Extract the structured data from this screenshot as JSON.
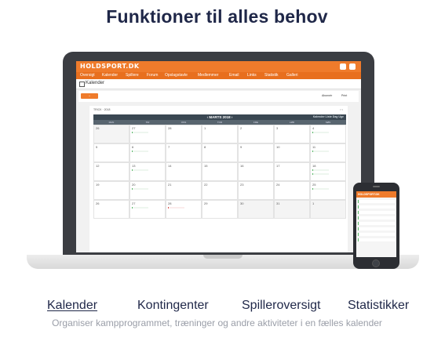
{
  "hero_title": "Funktioner til alles behov",
  "app": {
    "brand": "HOLDSPORT.DK",
    "nav": [
      "Oversigt",
      "Kalender",
      "Spillere",
      "Forum",
      "Opslagstavle",
      "Medlemmer",
      "Email",
      "Links",
      "Statistik",
      "Galleri"
    ],
    "page_title": "Kalender",
    "period_label": "TRICK · 2018",
    "toolbar_links": [
      "Abonnér",
      "Print"
    ],
    "month_title": "‹ MARTS 2018 ›",
    "views": "Kalender  Liste  Dag  Uge",
    "weekdays": [
      "MAN",
      "TIR",
      "ONS",
      "TOR",
      "FRE",
      "LØR",
      "SØN"
    ],
    "weeks": [
      [
        "26",
        "27",
        "28",
        "1",
        "2",
        "3",
        "4"
      ],
      [
        "5",
        "6",
        "7",
        "8",
        "9",
        "10",
        "11"
      ],
      [
        "12",
        "13",
        "14",
        "15",
        "16",
        "17",
        "18"
      ],
      [
        "19",
        "20",
        "21",
        "22",
        "23",
        "24",
        "25"
      ],
      [
        "26",
        "27",
        "28",
        "29",
        "30",
        "31",
        "1"
      ]
    ]
  },
  "phone": {
    "brand": "HOLDSPORT.DK"
  },
  "tabs": [
    {
      "label": "Kalender",
      "active": true
    },
    {
      "label": "Kontingenter",
      "active": false
    },
    {
      "label": "Spilleroversigt",
      "active": false
    },
    {
      "label": "Statistikker",
      "active": false
    }
  ],
  "tagline": "Organiser kampprogrammet, træninger og andre aktiviteter i en fælles kalender",
  "colors": {
    "accent": "#ef7b2b",
    "title": "#1f2748",
    "calendar_header": "#3a4752",
    "event_green": "#58b868"
  }
}
